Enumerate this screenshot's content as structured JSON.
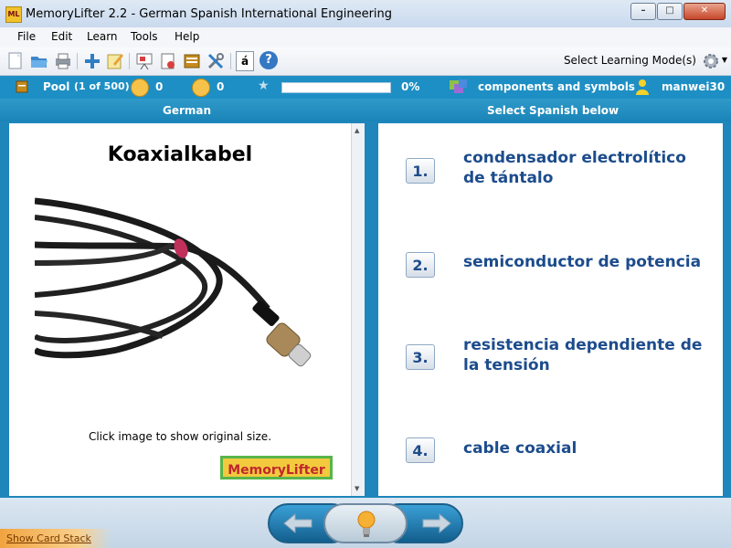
{
  "window": {
    "title": "MemoryLifter 2.2 - German Spanish International Engineering",
    "icon_text": "ML"
  },
  "menu": [
    "File",
    "Edit",
    "Learn",
    "Tools",
    "Help"
  ],
  "toolbar": {
    "icons": [
      "new-icon",
      "open-icon",
      "print-icon",
      "add-card-icon",
      "edit-card-icon",
      "presentation-icon",
      "print-cards-icon",
      "card-stack-icon",
      "tools-icon",
      "special-chars-icon",
      "help-icon"
    ],
    "special_char": "á",
    "help_char": "?",
    "mode_label": "Select Learning Mode(s)"
  },
  "status": {
    "pool_label": "Pool",
    "pool_count": "(1 of 500)",
    "right_count": "0",
    "wrong_count": "0",
    "progress_percent": 0,
    "progress_text": "0%",
    "chapter": "components and symbols",
    "user": "manwei30"
  },
  "headers": {
    "left": "German",
    "right": "Select Spanish below"
  },
  "question": {
    "word": "Koaxialkabel",
    "hint": "Click image to show original size.",
    "logo_text": "MemoryLifter"
  },
  "answers": [
    {
      "num": "1.",
      "text": "condensador electrolítico de tántalo"
    },
    {
      "num": "2.",
      "text": "semiconductor de potencia"
    },
    {
      "num": "3.",
      "text": "resistencia dependiente de la tensión"
    },
    {
      "num": "4.",
      "text": "cable coaxial"
    }
  ],
  "bottom": {
    "show_stack": "Show Card Stack"
  },
  "colors": {
    "accent": "#1e8fc4",
    "answer_text": "#1c4c8c",
    "stack_tab": "#f1a440"
  }
}
